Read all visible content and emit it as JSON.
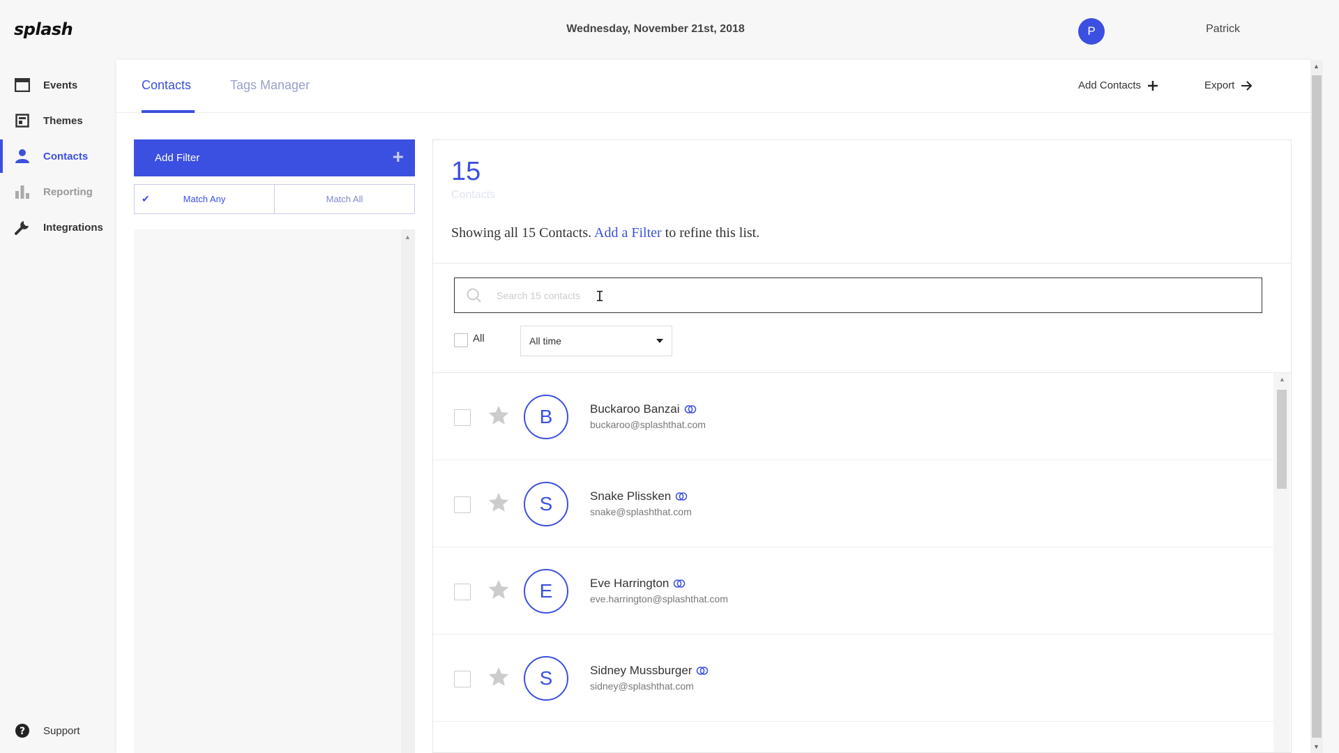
{
  "app": {
    "logo": "splash",
    "date": "Wednesday, November 21st, 2018",
    "user_name": "Patrick",
    "user_initial": "P",
    "accent_color": "#3b50e0"
  },
  "sidebar": {
    "items": [
      {
        "label": "Events",
        "icon": "calendar-icon"
      },
      {
        "label": "Themes",
        "icon": "themes-icon"
      },
      {
        "label": "Contacts",
        "icon": "person-icon",
        "active": true
      },
      {
        "label": "Reporting",
        "icon": "bar-chart-icon"
      },
      {
        "label": "Integrations",
        "icon": "wrench-icon"
      }
    ],
    "support": {
      "label": "Support",
      "icon": "help-circle-icon"
    }
  },
  "tabs": [
    {
      "label": "Contacts",
      "active": true
    },
    {
      "label": "Tags Manager",
      "active": false
    }
  ],
  "header_actions": {
    "add_contacts": "Add Contacts",
    "export": "Export"
  },
  "filters": {
    "add_filter": "Add Filter",
    "match_any": "Match Any",
    "match_all": "Match All",
    "selected": "Match Any"
  },
  "contacts": {
    "count": "15",
    "count_label": "Contacts",
    "summary_prefix": "Showing all 15 Contacts.",
    "summary_link": "Add a Filter",
    "summary_suffix": "to refine this list.",
    "search_placeholder": "Search 15 contacts",
    "select_all_label": "All",
    "timeframe": "All time",
    "rows": [
      {
        "initial": "B",
        "name": "Buckaroo Banzai",
        "email": "buckaroo@splashthat.com"
      },
      {
        "initial": "S",
        "name": "Snake Plissken",
        "email": "snake@splashthat.com"
      },
      {
        "initial": "E",
        "name": "Eve Harrington",
        "email": "eve.harrington@splashthat.com"
      },
      {
        "initial": "S",
        "name": "Sidney Mussburger",
        "email": "sidney@splashthat.com"
      }
    ]
  }
}
